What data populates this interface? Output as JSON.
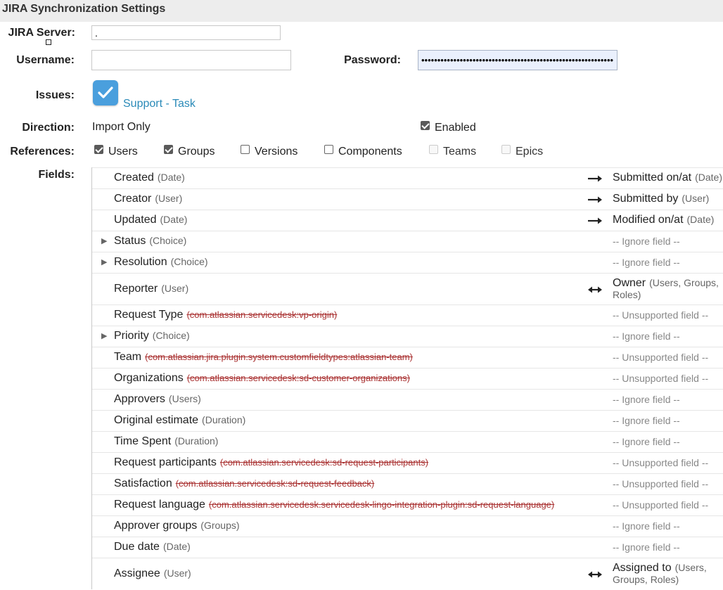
{
  "header": {
    "title": "JIRA Synchronization Settings"
  },
  "labels": {
    "server": "JIRA Server:",
    "username": "Username:",
    "password": "Password:",
    "issues": "Issues:",
    "direction": "Direction:",
    "references": "References:",
    "fields": "Fields:"
  },
  "form": {
    "server_value": ".",
    "username_value": "",
    "password_value": "••••••••••••••••••••••••••••••••••••••••••••••••••••••••••••"
  },
  "issues": {
    "label": "Support - Task",
    "checked": true
  },
  "direction": {
    "value": "Import Only",
    "enabled_label": "Enabled",
    "enabled_checked": true
  },
  "references": [
    {
      "label": "Users",
      "checked": true,
      "disabled": false
    },
    {
      "label": "Groups",
      "checked": true,
      "disabled": false
    },
    {
      "label": "Versions",
      "checked": false,
      "disabled": false
    },
    {
      "label": "Components",
      "checked": false,
      "disabled": false
    },
    {
      "label": "Teams",
      "checked": false,
      "disabled": true
    },
    {
      "label": "Epics",
      "checked": false,
      "disabled": true
    }
  ],
  "fields": [
    {
      "name": "Created",
      "type": "(Date)",
      "unsupported": false,
      "expandable": false,
      "arrow": "right",
      "target": "Submitted on/at",
      "target_type": "(Date)"
    },
    {
      "name": "Creator",
      "type": "(User)",
      "unsupported": false,
      "expandable": false,
      "arrow": "right",
      "target": "Submitted by",
      "target_type": "(User)"
    },
    {
      "name": "Updated",
      "type": "(Date)",
      "unsupported": false,
      "expandable": false,
      "arrow": "right",
      "target": "Modified on/at",
      "target_type": "(Date)"
    },
    {
      "name": "Status",
      "type": "(Choice)",
      "unsupported": false,
      "expandable": true,
      "arrow": "",
      "target": "-- Ignore field --",
      "target_type": ""
    },
    {
      "name": "Resolution",
      "type": "(Choice)",
      "unsupported": false,
      "expandable": true,
      "arrow": "",
      "target": "-- Ignore field --",
      "target_type": ""
    },
    {
      "name": "Reporter",
      "type": "(User)",
      "unsupported": false,
      "expandable": false,
      "arrow": "both",
      "target": "Owner",
      "target_type": "(Users, Groups, Roles)"
    },
    {
      "name": "Request Type",
      "type": "(com.atlassian.servicedesk:vp-origin)",
      "unsupported": true,
      "expandable": false,
      "arrow": "",
      "target": "-- Unsupported field --",
      "target_type": ""
    },
    {
      "name": "Priority",
      "type": "(Choice)",
      "unsupported": false,
      "expandable": true,
      "arrow": "",
      "target": "-- Ignore field --",
      "target_type": ""
    },
    {
      "name": "Team",
      "type": "(com.atlassian.jira.plugin.system.customfieldtypes:atlassian-team)",
      "unsupported": true,
      "expandable": false,
      "arrow": "",
      "target": "-- Unsupported field --",
      "target_type": ""
    },
    {
      "name": "Organizations",
      "type": "(com.atlassian.servicedesk:sd-customer-organizations)",
      "unsupported": true,
      "expandable": false,
      "arrow": "",
      "target": "-- Unsupported field --",
      "target_type": ""
    },
    {
      "name": "Approvers",
      "type": "(Users)",
      "unsupported": false,
      "expandable": false,
      "arrow": "",
      "target": "-- Ignore field --",
      "target_type": ""
    },
    {
      "name": "Original estimate",
      "type": "(Duration)",
      "unsupported": false,
      "expandable": false,
      "arrow": "",
      "target": "-- Ignore field --",
      "target_type": ""
    },
    {
      "name": "Time Spent",
      "type": "(Duration)",
      "unsupported": false,
      "expandable": false,
      "arrow": "",
      "target": "-- Ignore field --",
      "target_type": ""
    },
    {
      "name": "Request participants",
      "type": "(com.atlassian.servicedesk:sd-request-participants)",
      "unsupported": true,
      "expandable": false,
      "arrow": "",
      "target": "-- Unsupported field --",
      "target_type": ""
    },
    {
      "name": "Satisfaction",
      "type": "(com.atlassian.servicedesk:sd-request-feedback)",
      "unsupported": true,
      "expandable": false,
      "arrow": "",
      "target": "-- Unsupported field --",
      "target_type": ""
    },
    {
      "name": "Request language",
      "type": "(com.atlassian.servicedesk.servicedesk-lingo-integration-plugin:sd-request-language)",
      "unsupported": true,
      "expandable": false,
      "arrow": "",
      "target": "-- Unsupported field --",
      "target_type": ""
    },
    {
      "name": "Approver groups",
      "type": "(Groups)",
      "unsupported": false,
      "expandable": false,
      "arrow": "",
      "target": "-- Ignore field --",
      "target_type": ""
    },
    {
      "name": "Due date",
      "type": "(Date)",
      "unsupported": false,
      "expandable": false,
      "arrow": "",
      "target": "-- Ignore field --",
      "target_type": ""
    },
    {
      "name": "Assignee",
      "type": "(User)",
      "unsupported": false,
      "expandable": false,
      "arrow": "both",
      "target": "Assigned to",
      "target_type": "(Users, Groups, Roles)"
    }
  ]
}
